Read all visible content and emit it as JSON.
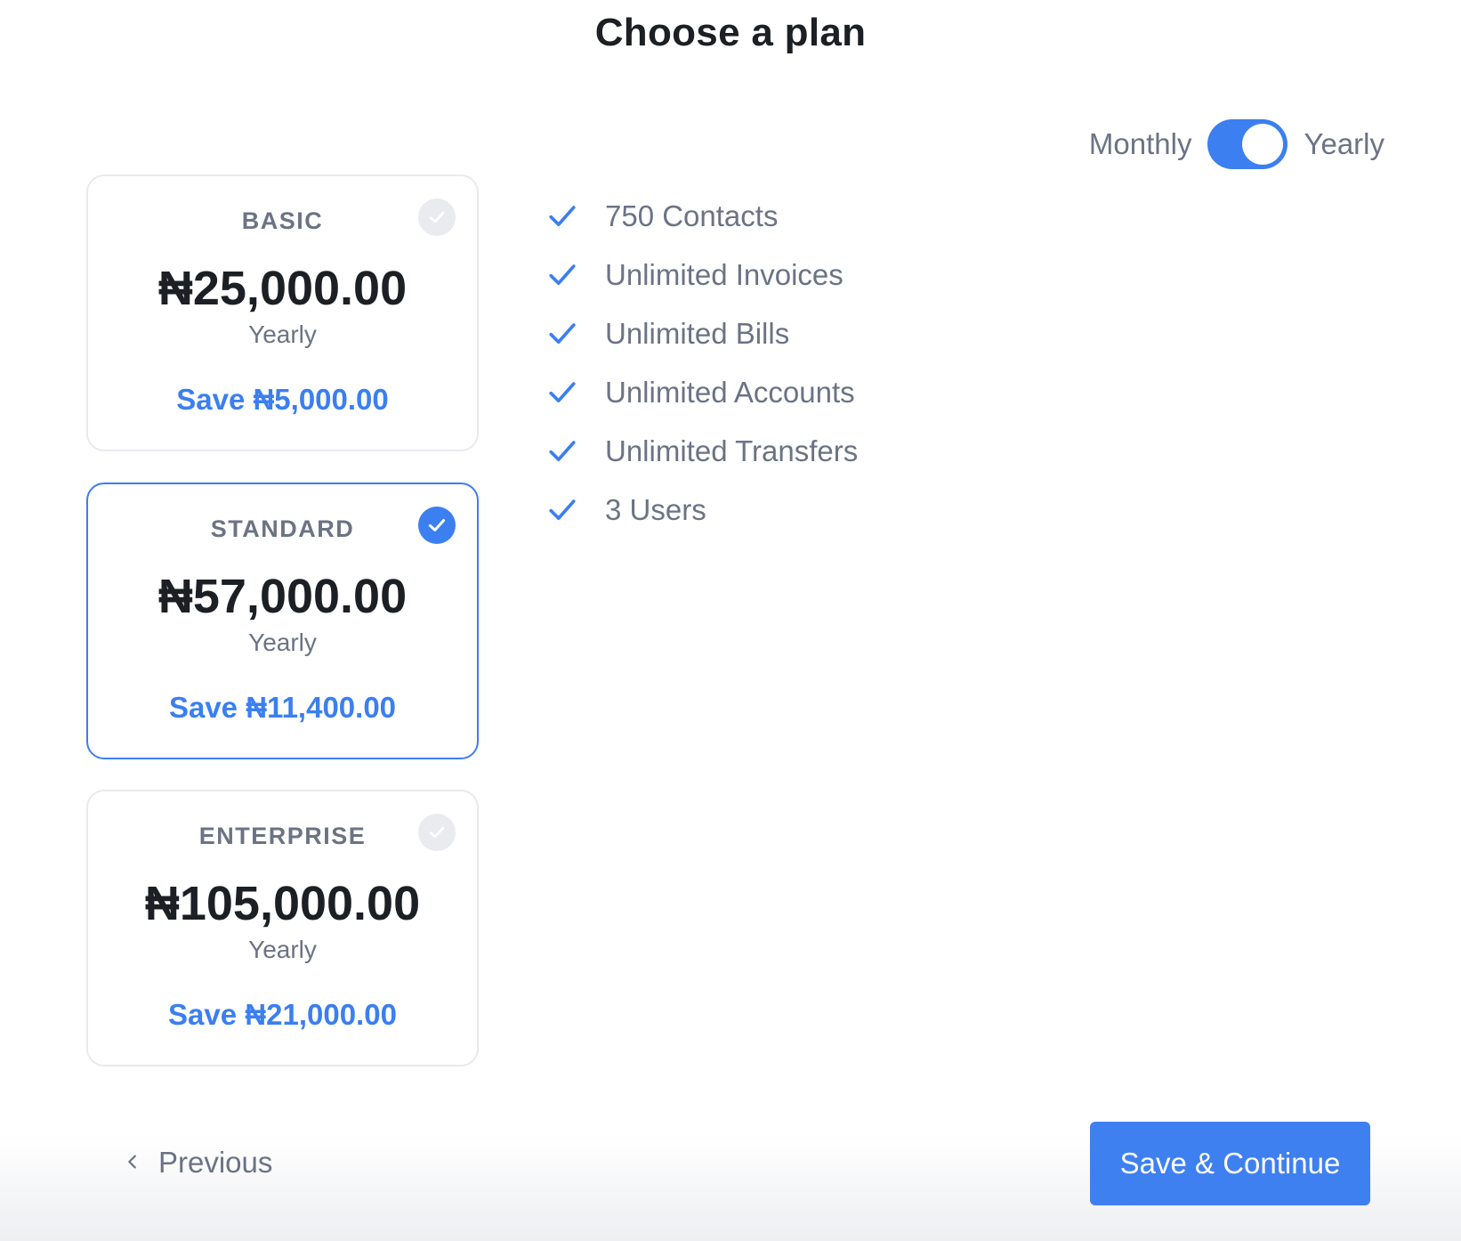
{
  "page": {
    "title": "Choose a plan"
  },
  "billing": {
    "monthly_label": "Monthly",
    "yearly_label": "Yearly",
    "selected": "Yearly"
  },
  "plans": [
    {
      "name": "BASIC",
      "price": "₦25,000.00",
      "period": "Yearly",
      "savings": "Save ₦5,000.00",
      "selected": false
    },
    {
      "name": "STANDARD",
      "price": "₦57,000.00",
      "period": "Yearly",
      "savings": "Save ₦11,400.00",
      "selected": true
    },
    {
      "name": "ENTERPRISE",
      "price": "₦105,000.00",
      "period": "Yearly",
      "savings": "Save ₦21,000.00",
      "selected": false
    }
  ],
  "features": [
    "750 Contacts",
    "Unlimited Invoices",
    "Unlimited Bills",
    "Unlimited Accounts",
    "Unlimited Transfers",
    "3 Users"
  ],
  "footer": {
    "previous_label": "Previous",
    "save_label": "Save & Continue"
  },
  "icons": {
    "feature_check": "check-icon",
    "selection_badge": "check-circle-icon",
    "previous": "chevron-left-icon"
  },
  "colors": {
    "accent": "#3b7ff0",
    "muted_text": "#6b7384",
    "heading_text": "#1c1f24",
    "unselected_badge": "#e9ebef"
  }
}
